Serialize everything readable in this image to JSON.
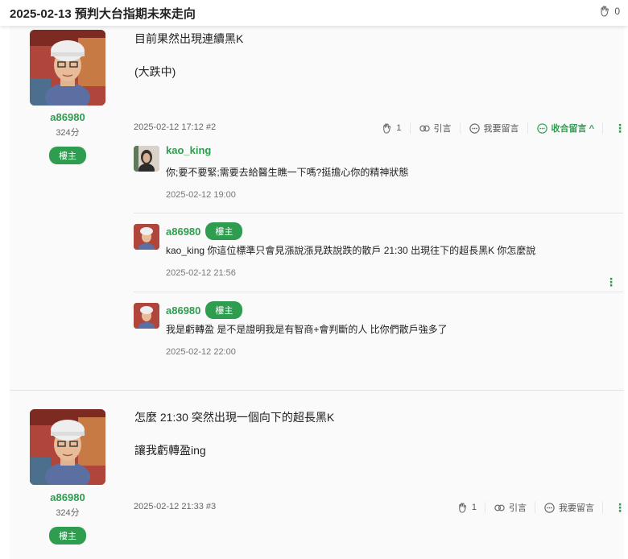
{
  "thread": {
    "title": "2025-02-13 預判大台指期未來走向",
    "like_count": "0"
  },
  "posts": [
    {
      "author": "a86980",
      "score": "324分",
      "badge": "樓主",
      "lines": [
        "目前果然出現連續黑K",
        "(大跌中)"
      ],
      "timestamp": "2025-02-12 17:12 #2",
      "likes": "1",
      "quote_label": "引言",
      "reply_label": "我要留言",
      "collapse_label": "收合留言 ^",
      "more": "⋮",
      "replies": [
        {
          "author": "kao_king",
          "text": "你;要不要緊;需要去給醫生瞧一下嗎?挺擔心你的精神狀態",
          "time": "2025-02-12 19:00"
        },
        {
          "author": "a86980",
          "badge": "樓主",
          "text": "kao_king 你這位標準只會見漲說漲見跌說跌的散戶 21:30 出現往下的超長黑K 你怎麼說",
          "time": "2025-02-12 21:56",
          "more": "⋮"
        },
        {
          "author": "a86980",
          "badge": "樓主",
          "text": "我是虧轉盈 是不是證明我是有智商+會判斷的人 比你們散戶強多了",
          "time": "2025-02-12 22:00"
        }
      ]
    },
    {
      "author": "a86980",
      "score": "324分",
      "badge": "樓主",
      "lines": [
        "怎麼 21:30 突然出現一個向下的超長黑K",
        "讓我虧轉盈ing"
      ],
      "timestamp": "2025-02-12 21:33 #3",
      "likes": "1",
      "quote_label": "引言",
      "reply_label": "我要留言",
      "more": "⋮"
    }
  ],
  "colors": {
    "accent_green": "#2e9d4f",
    "page_bg": "#fafafa"
  },
  "icons": [
    "clap-icon",
    "quote-icon",
    "comment-icon",
    "more-icon"
  ]
}
